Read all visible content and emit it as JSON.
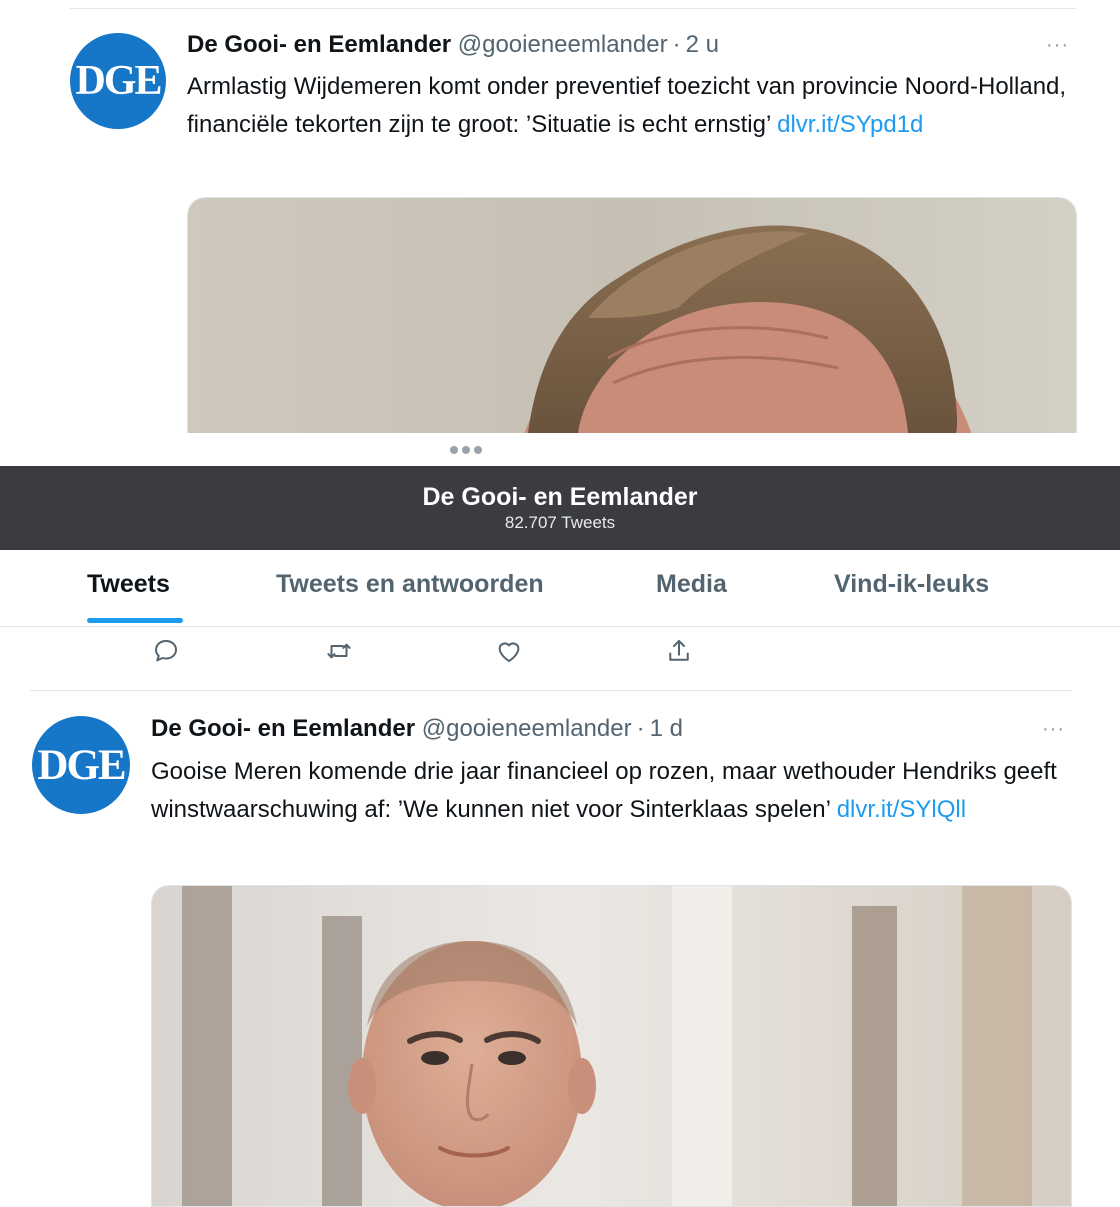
{
  "tweet1": {
    "avatar_text": "DGE",
    "name": "De Gooi- en Eemlander",
    "handle": "@gooieneemlander",
    "separator": "·",
    "time": "2 u",
    "more": "···",
    "text": "Armlastig Wijdemeren komt onder preventief toezicht van provincie Noord-Holland, financiële tekorten zijn te groot: ’Situatie is echt ernstig’",
    "link": "dlvr.it/SYpd1d"
  },
  "header": {
    "title": "De Gooi- en Eemlander",
    "tweet_count": "82.707 Tweets"
  },
  "tabs": [
    {
      "label": "Tweets",
      "active": true
    },
    {
      "label": "Tweets en antwoorden",
      "active": false
    },
    {
      "label": "Media",
      "active": false
    },
    {
      "label": "Vind-ik-leuks",
      "active": false
    }
  ],
  "actions": [
    {
      "icon": "reply-icon"
    },
    {
      "icon": "retweet-icon"
    },
    {
      "icon": "like-icon"
    },
    {
      "icon": "share-icon"
    }
  ],
  "tweet2": {
    "avatar_text": "DGE",
    "name": "De Gooi- en Eemlander",
    "handle": "@gooieneemlander",
    "separator": "·",
    "time": "1 d",
    "more": "···",
    "text": "Gooise Meren komende drie jaar financieel op rozen, maar wethouder Hendriks geeft winstwaarschuwing af: ’We kunnen niet voor Sinterklaas spelen’",
    "link": "dlvr.it/SYlQll"
  },
  "colors": {
    "accent": "#1d9bf0",
    "brand_avatar": "#1676c7",
    "header_bg": "#3a3c41"
  }
}
